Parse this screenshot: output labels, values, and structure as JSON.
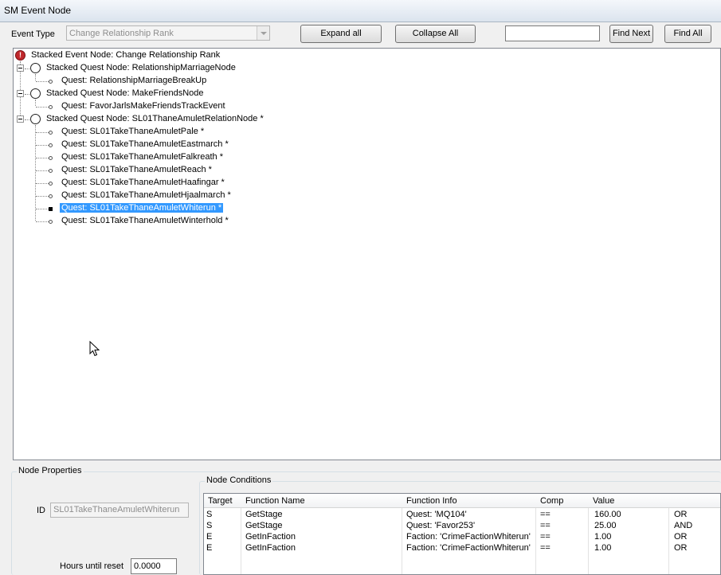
{
  "window": {
    "title": "SM Event Node"
  },
  "toolbar": {
    "event_type_label": "Event Type",
    "event_type_value": "Change Relationship Rank",
    "expand_all": "Expand all",
    "collapse_all": "Collapse All",
    "search_value": "",
    "find_next": "Find Next",
    "find_all": "Find All"
  },
  "tree": {
    "root": "Stacked Event Node: Change Relationship Rank",
    "nodes": [
      {
        "label": "Stacked Quest Node: RelationshipMarriageNode",
        "children": [
          "Quest: RelationshipMarriageBreakUp"
        ]
      },
      {
        "label": "Stacked Quest Node: MakeFriendsNode",
        "children": [
          "Quest: FavorJarlsMakeFriendsTrackEvent"
        ]
      },
      {
        "label": "Stacked Quest Node: SL01ThaneAmuletRelationNode *",
        "children": [
          "Quest: SL01TakeThaneAmuletPale *",
          "Quest: SL01TakeThaneAmuletEastmarch *",
          "Quest: SL01TakeThaneAmuletFalkreath *",
          "Quest: SL01TakeThaneAmuletReach *",
          "Quest: SL01TakeThaneAmuletHaafingar *",
          "Quest: SL01TakeThaneAmuletHjaalmarch *",
          "Quest: SL01TakeThaneAmuletWhiterun *",
          "Quest: SL01TakeThaneAmuletWinterhold *"
        ]
      }
    ],
    "selected": "Quest: SL01TakeThaneAmuletWhiterun *"
  },
  "node_properties": {
    "legend": "Node Properties",
    "id_label": "ID",
    "id_value": "SL01TakeThaneAmuletWhiterun",
    "hours_label": "Hours until reset",
    "hours_value": "0.0000"
  },
  "node_conditions": {
    "legend": "Node Conditions",
    "columns": [
      "Target",
      "Function Name",
      "Function Info",
      "Comp",
      "Value",
      ""
    ],
    "rows": [
      [
        "S",
        "GetStage",
        "Quest: 'MQ104'",
        "==",
        "160.00",
        "OR"
      ],
      [
        "S",
        "GetStage",
        "Quest: 'Favor253'",
        "==",
        "25.00",
        "AND"
      ],
      [
        "E",
        "GetInFaction",
        "Faction: 'CrimeFactionWhiterun'",
        "==",
        "1.00",
        "OR"
      ],
      [
        "E",
        "GetInFaction",
        "Faction: 'CrimeFactionWhiterun'",
        "==",
        "1.00",
        "OR"
      ]
    ]
  }
}
